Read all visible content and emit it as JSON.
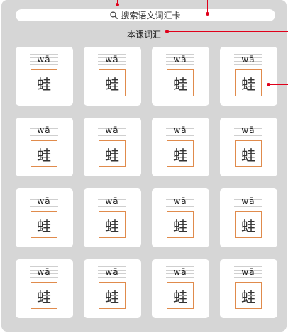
{
  "search": {
    "label": "搜索语文词汇卡",
    "icon": "search-icon"
  },
  "section": {
    "title": "本课词汇"
  },
  "cards": [
    {
      "pinyin": "wā",
      "char": "蛙"
    },
    {
      "pinyin": "wā",
      "char": "蛙"
    },
    {
      "pinyin": "wā",
      "char": "蛙"
    },
    {
      "pinyin": "wā",
      "char": "蛙"
    },
    {
      "pinyin": "wā",
      "char": "蛙"
    },
    {
      "pinyin": "wā",
      "char": "蛙"
    },
    {
      "pinyin": "wā",
      "char": "蛙"
    },
    {
      "pinyin": "wā",
      "char": "蛙"
    },
    {
      "pinyin": "wā",
      "char": "蛙"
    },
    {
      "pinyin": "wā",
      "char": "蛙"
    },
    {
      "pinyin": "wā",
      "char": "蛙"
    },
    {
      "pinyin": "wā",
      "char": "蛙"
    },
    {
      "pinyin": "wā",
      "char": "蛙"
    },
    {
      "pinyin": "wā",
      "char": "蛙"
    },
    {
      "pinyin": "wā",
      "char": "蛙"
    },
    {
      "pinyin": "wā",
      "char": "蛙"
    }
  ],
  "colors": {
    "panel": "#d6d6d6",
    "card": "#ffffff",
    "char_border": "#e08b4c",
    "annotation": "#e0001a"
  }
}
